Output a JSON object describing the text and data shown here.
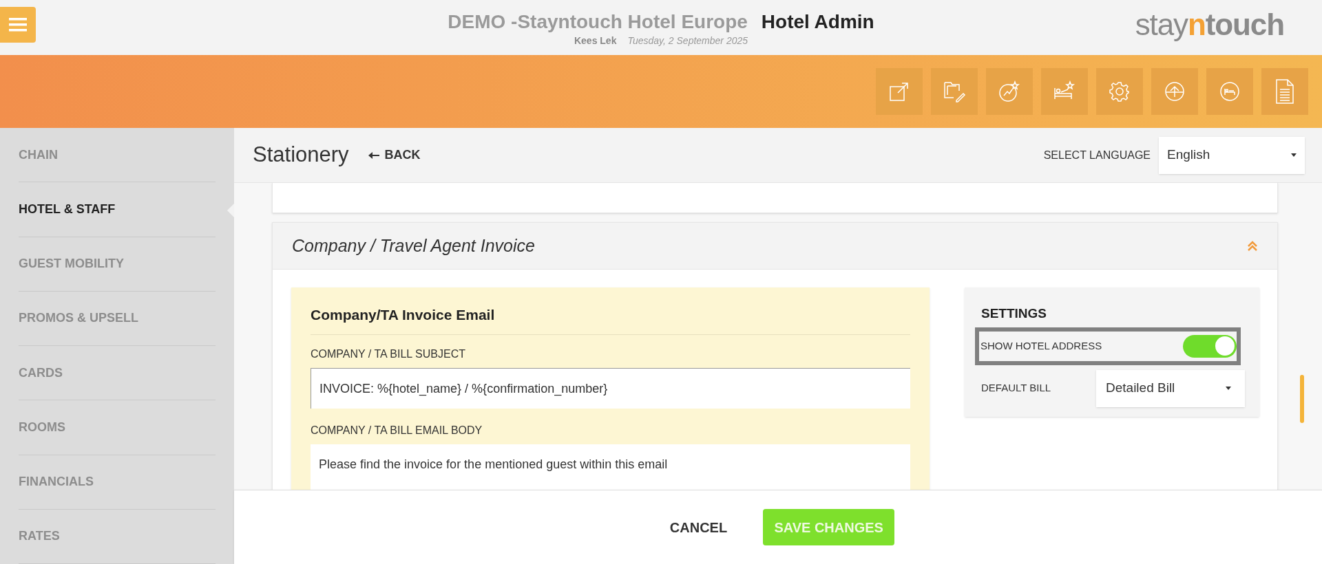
{
  "header": {
    "hotel": "DEMO -Stayntouch Hotel Europe",
    "app": "Hotel Admin",
    "user": "Kees Lek",
    "date": "Tuesday, 2 September 2025",
    "logo": {
      "before": "stay",
      "accent": "n",
      "after": "touch"
    }
  },
  "sidebar": {
    "items": [
      {
        "label": "CHAIN",
        "selected": false
      },
      {
        "label": "HOTEL & STAFF",
        "selected": true
      },
      {
        "label": "GUEST MOBILITY",
        "selected": false
      },
      {
        "label": "PROMOS & UPSELL",
        "selected": false
      },
      {
        "label": "CARDS",
        "selected": false
      },
      {
        "label": "ROOMS",
        "selected": false
      },
      {
        "label": "FINANCIALS",
        "selected": false
      },
      {
        "label": "RATES",
        "selected": false
      }
    ]
  },
  "page": {
    "title": "Stationery",
    "back": "BACK",
    "language_label": "SELECT LANGUAGE",
    "language": "English"
  },
  "section": {
    "title": "Company / Travel Agent Invoice",
    "expanded": true,
    "email_panel": {
      "title": "Company/TA Invoice Email",
      "fields": [
        {
          "label": "COMPANY / TA BILL SUBJECT",
          "value": "INVOICE: %{hotel_name} / %{confirmation_number}"
        },
        {
          "label": "COMPANY / TA BILL EMAIL BODY",
          "value": "Please find the invoice for the mentioned guest within this email"
        }
      ]
    },
    "settings": {
      "title": "SETTINGS",
      "toggle": {
        "label": "SHOW HOTEL ADDRESS",
        "on": true
      },
      "default_bill": {
        "label": "DEFAULT BILL",
        "value": "Detailed Bill"
      }
    }
  },
  "footer": {
    "cancel": "CANCEL",
    "save": "SAVE CHANGES"
  }
}
